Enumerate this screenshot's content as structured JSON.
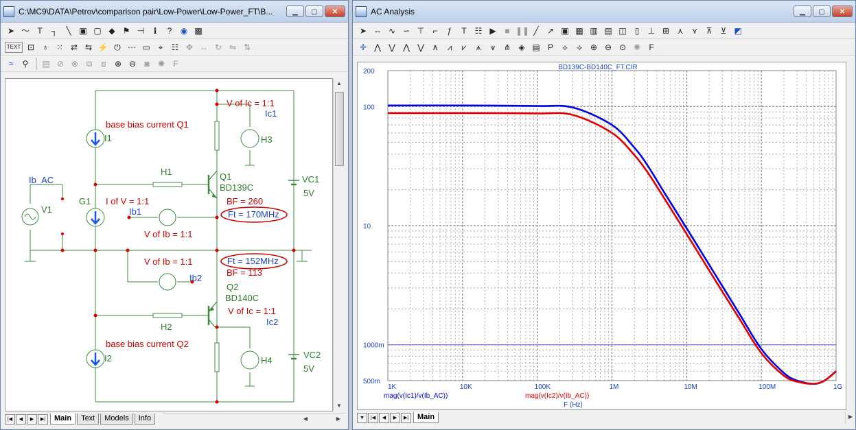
{
  "schematic_window": {
    "title": "C:\\MC9\\DATA\\Petrov\\comparison pair\\Low-Power\\Low-Power_FT\\B...",
    "tabs": [
      "Main",
      "Text",
      "Models",
      "Info"
    ],
    "active_tab": "Main"
  },
  "schematic": {
    "labels": {
      "base_bias_q1": "base bias current Q1",
      "i1": "I1",
      "v_of_ic_top": "V of Ic = 1:1",
      "ic1": "Ic1",
      "h3": "H3",
      "h1": "H1",
      "q1": "Q1",
      "bd139c": "BD139C",
      "vc1": "VC1",
      "vc1_value": "5V",
      "ib_ac": "Ib_AC",
      "v1": "V1",
      "g1": "G1",
      "i_of_v": "I of V = 1:1",
      "bf_q1": "BF = 260",
      "ib1": "Ib1",
      "ft_q1": "Ft = 170MHz",
      "v_of_ib_top": "V of Ib = 1:1",
      "v_of_ib_mid": "V of Ib = 1:1",
      "ft_q2": "Ft = 152MHz",
      "ib2": "Ib2",
      "bf_q2": "BF = 113",
      "q2": "Q2",
      "bd140c": "BD140C",
      "v_of_ic_bottom": "V of Ic = 1:1",
      "ic2": "Ic2",
      "h2": "H2",
      "base_bias_q2": "base bias current Q2",
      "h4": "H4",
      "i2": "I2",
      "vc2": "VC2",
      "vc2_value": "5V"
    }
  },
  "analysis_window": {
    "title": "AC Analysis",
    "tabs": [
      "Main"
    ],
    "active_tab": "Main"
  },
  "chart_data": {
    "type": "line",
    "title": "BD139C-BD140C_FT.CIR",
    "xlabel": "F (Hz)",
    "x_scale": "log",
    "y_scale": "log",
    "xlim": [
      1000,
      1000000000
    ],
    "ylim": [
      0.5,
      200
    ],
    "x_ticks": [
      {
        "value": 1000,
        "label": "1K"
      },
      {
        "value": 10000,
        "label": "10K"
      },
      {
        "value": 100000,
        "label": "100K"
      },
      {
        "value": 1000000,
        "label": "1M"
      },
      {
        "value": 10000000,
        "label": "10M"
      },
      {
        "value": 100000000,
        "label": "100M"
      },
      {
        "value": 1000000000,
        "label": "1G"
      }
    ],
    "y_ticks": [
      {
        "value": 200,
        "label": "200"
      },
      {
        "value": 100,
        "label": "100"
      },
      {
        "value": 10,
        "label": "10"
      },
      {
        "value": 1,
        "label": "1000m"
      },
      {
        "value": 0.5,
        "label": "500m"
      }
    ],
    "grid": true,
    "series": [
      {
        "name": "mag(v(Ic1)/v(Ib_AC))",
        "color": "#0000e0",
        "x": [
          1000,
          10000,
          100000,
          300000,
          1000000,
          2000000,
          3000000,
          5000000,
          10000000,
          20000000,
          50000000,
          100000000,
          200000000,
          300000000,
          500000000,
          700000000,
          1000000000
        ],
        "y": [
          102,
          102,
          101,
          98,
          70,
          45,
          32,
          19,
          9.5,
          4.7,
          1.85,
          0.92,
          0.58,
          0.5,
          0.47,
          0.5,
          0.6
        ]
      },
      {
        "name": "mag(v(Ic2)/v(Ib_AC))",
        "color": "#e00000",
        "x": [
          1000,
          10000,
          100000,
          300000,
          1000000,
          2000000,
          3000000,
          5000000,
          10000000,
          20000000,
          50000000,
          100000000,
          200000000,
          300000000,
          500000000,
          700000000,
          1000000000
        ],
        "y": [
          88,
          88,
          87.5,
          85,
          60,
          39,
          28,
          17,
          8.5,
          4.2,
          1.68,
          0.85,
          0.55,
          0.49,
          0.47,
          0.5,
          0.6
        ]
      }
    ]
  }
}
